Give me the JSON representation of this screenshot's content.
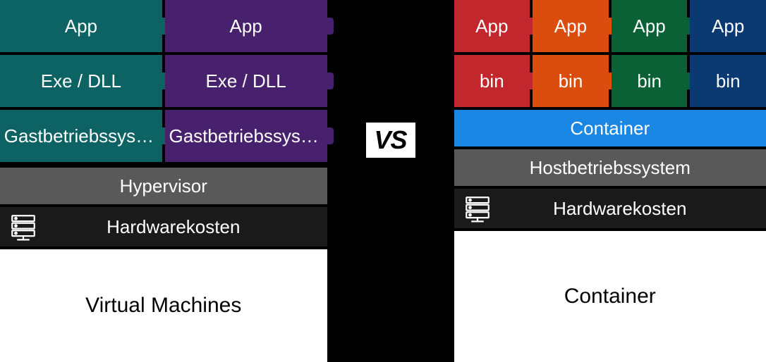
{
  "vs_label": "VS",
  "left": {
    "title": "Virtual Machines",
    "hypervisor": "Hypervisor",
    "hardware": "Hardwarekosten",
    "vms": [
      {
        "app": "App",
        "exe": "Exe / DLL",
        "os": "Gastbetriebssystem",
        "color": "teal"
      },
      {
        "app": "App",
        "exe": "Exe / DLL",
        "os": "Gastbetriebssystem",
        "color": "purple"
      }
    ]
  },
  "right": {
    "title": "Container",
    "container_engine": "Container",
    "host_os": "Hostbetriebssystem",
    "hardware": "Hardwarekosten",
    "containers": [
      {
        "app": "App",
        "bin": "bin",
        "color": "red"
      },
      {
        "app": "App",
        "bin": "bin",
        "color": "orange"
      },
      {
        "app": "App",
        "bin": "bin",
        "color": "green"
      },
      {
        "app": "App",
        "bin": "bin",
        "color": "navy"
      }
    ]
  }
}
